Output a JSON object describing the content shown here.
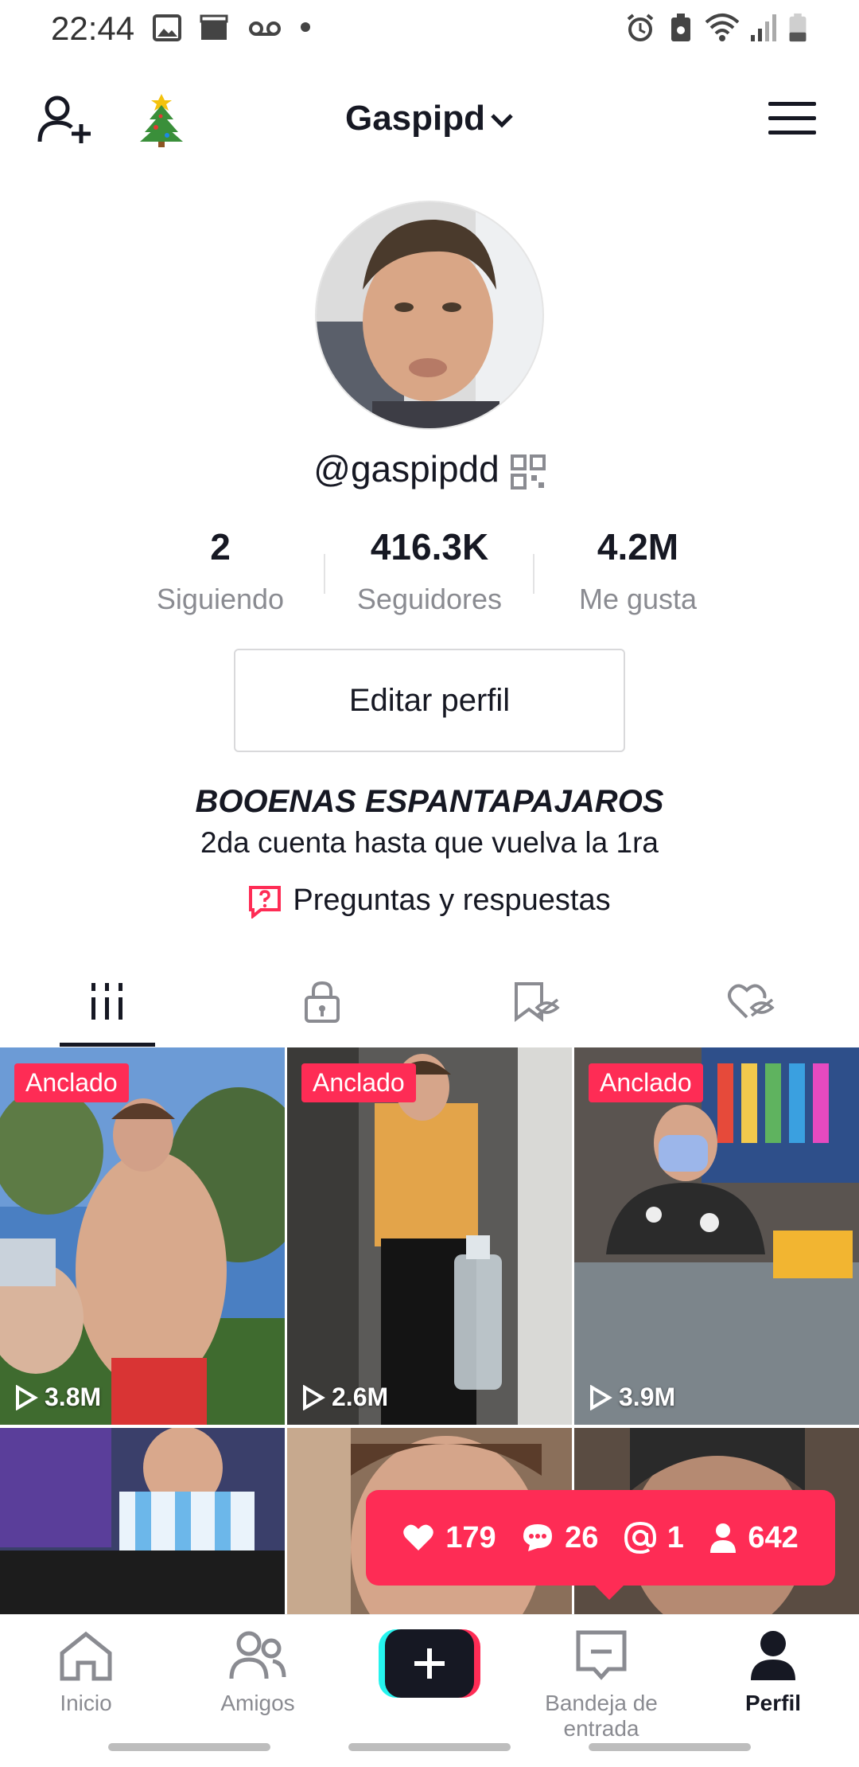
{
  "status_bar": {
    "time": "22:44"
  },
  "header": {
    "title": "Gaspipd"
  },
  "profile": {
    "handle": "@gaspipdd",
    "stats": [
      {
        "value": "2",
        "label": "Siguiendo"
      },
      {
        "value": "416.3K",
        "label": "Seguidores"
      },
      {
        "value": "4.2M",
        "label": "Me gusta"
      }
    ],
    "edit_label": "Editar perfil",
    "bio_title": "BOOENAS ESPANTAPAJAROS",
    "bio_text": "2da cuenta hasta que vuelva la 1ra",
    "qa_label": "Preguntas y respuestas"
  },
  "tabs": [
    "videos-grid-icon",
    "lock-icon",
    "saved-hidden-icon",
    "liked-hidden-icon"
  ],
  "videos": [
    {
      "badge": "Anclado",
      "views": "3.8M"
    },
    {
      "badge": "Anclado",
      "views": "2.6M"
    },
    {
      "badge": "Anclado",
      "views": "3.9M"
    }
  ],
  "notification": {
    "likes": "179",
    "comments": "26",
    "mentions": "1",
    "followers": "642"
  },
  "nav": {
    "home": "Inicio",
    "friends": "Amigos",
    "inbox": "Bandeja de entrada",
    "profile": "Perfil"
  },
  "colors": {
    "accent": "#fe2c55",
    "text": "#161823",
    "muted": "#8a8b91"
  }
}
